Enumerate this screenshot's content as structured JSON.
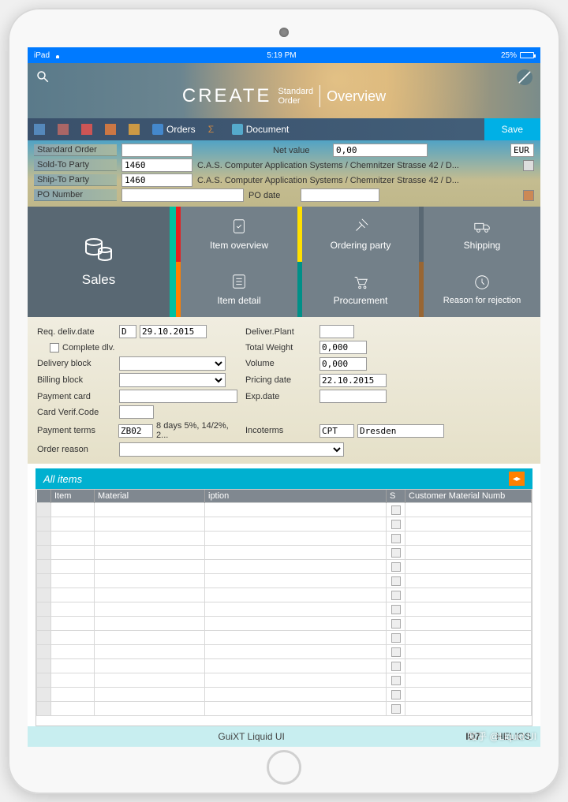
{
  "statusbar": {
    "carrier": "iPad",
    "time": "5:19 PM",
    "battery": "25%"
  },
  "header": {
    "title_main": "CREATE",
    "title_sub1": "Standard",
    "title_sub2": "Order",
    "overview": "Overview"
  },
  "toolbar": {
    "orders": "Orders",
    "document": "Document",
    "save": "Save"
  },
  "form_top": {
    "standard_order_label": "Standard Order",
    "standard_order_value": "",
    "net_value_label": "Net value",
    "net_value_value": "0,00",
    "currency": "EUR",
    "sold_to_label": "Sold-To Party",
    "sold_to_value": "1460",
    "sold_to_text": "C.A.S. Computer Application Systems / Chemnitzer Strasse 42 / D...",
    "ship_to_label": "Ship-To Party",
    "ship_to_value": "1460",
    "ship_to_text": "C.A.S. Computer Application Systems / Chemnitzer Strasse 42 / D...",
    "po_number_label": "PO Number",
    "po_number_value": "",
    "po_date_label": "PO date",
    "po_date_value": ""
  },
  "tiles": {
    "sales": "Sales",
    "item_overview": "Item overview",
    "ordering_party": "Ordering party",
    "shipping": "Shipping",
    "item_detail": "Item detail",
    "procurement": "Procurement",
    "reason_rejection": "Reason for rejection"
  },
  "form_mid": {
    "req_deliv_label": "Req. deliv.date",
    "req_deliv_type": "D",
    "req_deliv_value": "29.10.2015",
    "deliver_plant_label": "Deliver.Plant",
    "deliver_plant_value": "",
    "complete_dlv_label": "Complete dlv.",
    "total_weight_label": "Total Weight",
    "total_weight_value": "0,000",
    "delivery_block_label": "Delivery block",
    "volume_label": "Volume",
    "volume_value": "0,000",
    "billing_block_label": "Billing block",
    "pricing_date_label": "Pricing date",
    "pricing_date_value": "22.10.2015",
    "payment_card_label": "Payment card",
    "payment_card_value": "",
    "exp_date_label": "Exp.date",
    "exp_date_value": "",
    "card_verif_label": "Card Verif.Code",
    "card_verif_value": "",
    "payment_terms_label": "Payment terms",
    "payment_terms_value": "ZB02",
    "payment_terms_text": "8 days 5%, 14/2%, 2...",
    "incoterms_label": "Incoterms",
    "incoterms_value1": "CPT",
    "incoterms_value2": "Dresden",
    "order_reason_label": "Order reason"
  },
  "all_items": {
    "title": "All items"
  },
  "table": {
    "columns": [
      "",
      "Item",
      "Material",
      "iption",
      "S",
      "Customer Material Numb"
    ]
  },
  "footer": {
    "center": "GuiXT Liquid UI",
    "id": "ID7",
    "right": "HELIOS"
  },
  "watermark": "知乎 @Liquid UI"
}
